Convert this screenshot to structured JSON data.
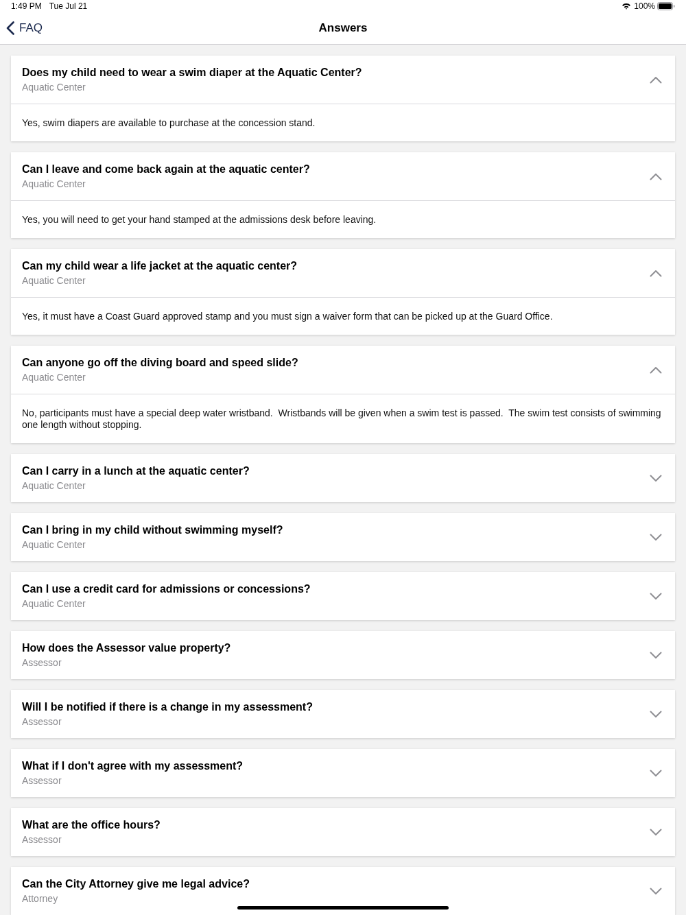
{
  "status_bar": {
    "time": "1:49 PM",
    "date": "Tue Jul 21",
    "battery": "100%"
  },
  "nav_bar": {
    "back_label": "FAQ",
    "title": "Answers"
  },
  "faqs": [
    {
      "question": "Does my child need to wear a swim diaper at the Aquatic Center?",
      "category": "Aquatic Center",
      "expanded": true,
      "answer": "Yes, swim diapers are available to purchase at the concession stand."
    },
    {
      "question": "Can I leave and come back again at the aquatic center?",
      "category": "Aquatic Center",
      "expanded": true,
      "answer": "Yes, you will need to get your hand stamped at the admissions desk before leaving."
    },
    {
      "question": "Can my child wear a life jacket at the aquatic center?",
      "category": "Aquatic Center",
      "expanded": true,
      "answer": "Yes, it must have a Coast Guard approved stamp and you must sign a waiver form that can be picked up at the Guard Office."
    },
    {
      "question": "Can anyone go off the diving board and speed slide?",
      "category": "Aquatic Center",
      "expanded": true,
      "answer": "No, participants must have a special deep water wristband.  Wristbands will be given when a swim test is passed.  The swim test consists of swimming one length without stopping."
    },
    {
      "question": "Can I carry in a lunch at the aquatic center?",
      "category": "Aquatic Center",
      "expanded": false
    },
    {
      "question": "Can I bring in my child without swimming myself?",
      "category": "Aquatic Center",
      "expanded": false
    },
    {
      "question": "Can I use a credit card for admissions or concessions?",
      "category": "Aquatic Center",
      "expanded": false
    },
    {
      "question": "How does the Assessor value property?",
      "category": "Assessor",
      "expanded": false
    },
    {
      "question": "Will I be notified if there is a change in my assessment?",
      "category": "Assessor",
      "expanded": false
    },
    {
      "question": "What if I don't agree with my assessment?",
      "category": "Assessor",
      "expanded": false
    },
    {
      "question": "What are the office hours?",
      "category": "Assessor",
      "expanded": false
    },
    {
      "question": "Can the City Attorney give me legal advice?",
      "category": "Attorney",
      "expanded": false
    }
  ]
}
